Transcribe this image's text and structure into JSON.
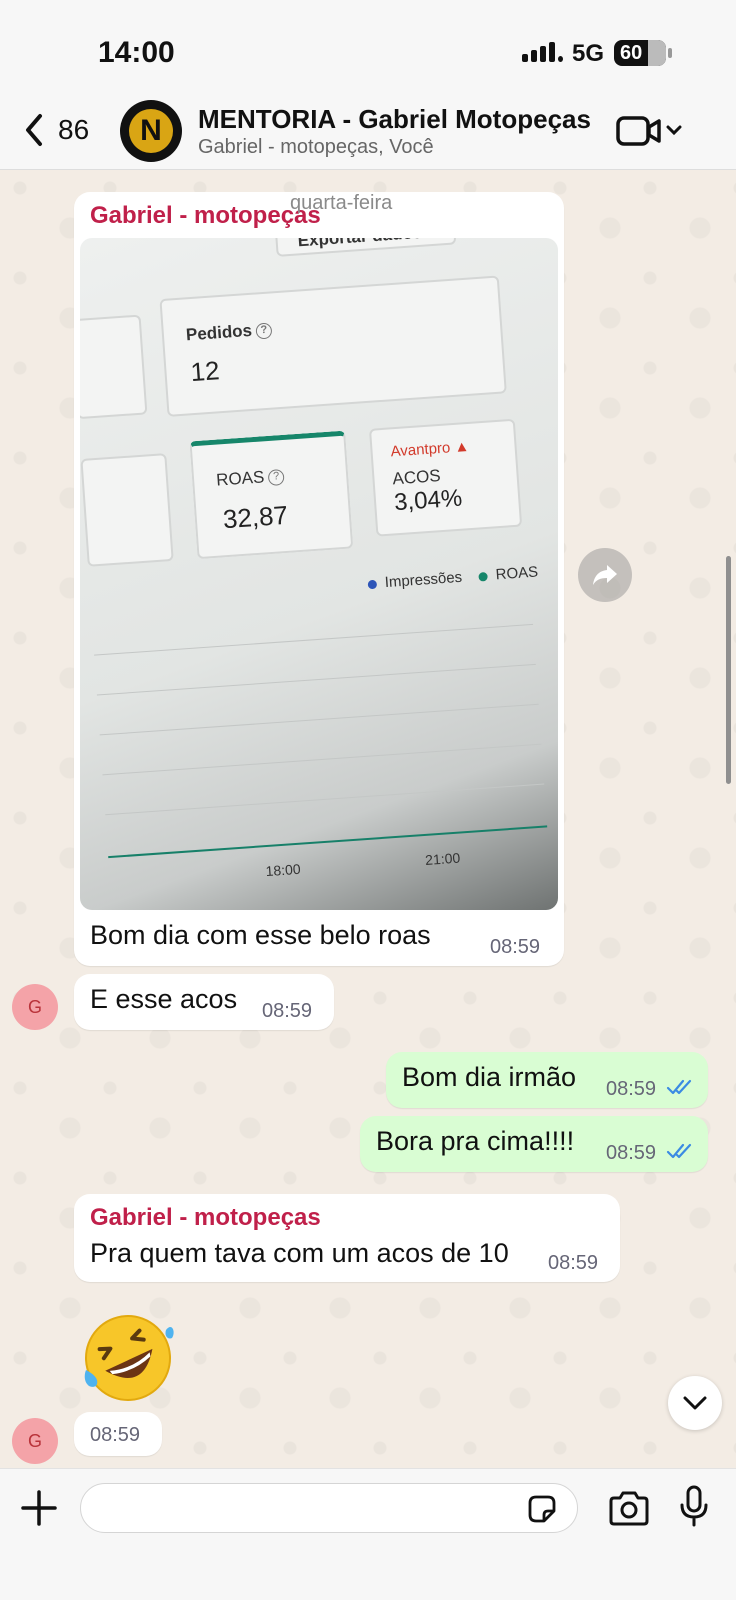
{
  "status_bar": {
    "time": "14:00",
    "network": "5G",
    "battery": "60"
  },
  "header": {
    "back_count": "86",
    "avatar_letter": "N",
    "title": "MENTORIA - Gabriel Motopeças",
    "subtitle": "Gabriel - motopeças, Você"
  },
  "day_label": "quarta-feira",
  "messages": [
    {
      "sender": "Gabriel - motopeças",
      "photo": {
        "export_label": "Exportar dados",
        "pedidos_label": "Pedidos",
        "pedidos_value": "12",
        "roas_label": "ROAS",
        "roas_value": "32,87",
        "brand": "Avantpro",
        "acos_label": "ACOS",
        "acos_value": "3,04%",
        "legend_1": "Impressões",
        "legend_2": "ROAS",
        "tick_1": "18:00",
        "tick_2": "21:00"
      },
      "text": "Bom dia com esse belo roas",
      "time": "08:59"
    },
    {
      "avatar": "G",
      "text": "E esse acos",
      "time": "08:59"
    },
    {
      "text": "Bom dia irmão",
      "time": "08:59"
    },
    {
      "text": "Bora pra cima!!!!",
      "time": "08:59"
    },
    {
      "sender": "Gabriel - motopeças",
      "text": "Pra quem tava com um acos de 10",
      "time": "08:59"
    },
    {
      "avatar": "G",
      "emoji": "rolling-on-floor-laughing",
      "time": "08:59"
    }
  ],
  "composer": {
    "placeholder": ""
  },
  "colors": {
    "sender": "#c0204a",
    "outgoing_bubble": "#d9fdd3",
    "ticks": "#3b8be3"
  }
}
